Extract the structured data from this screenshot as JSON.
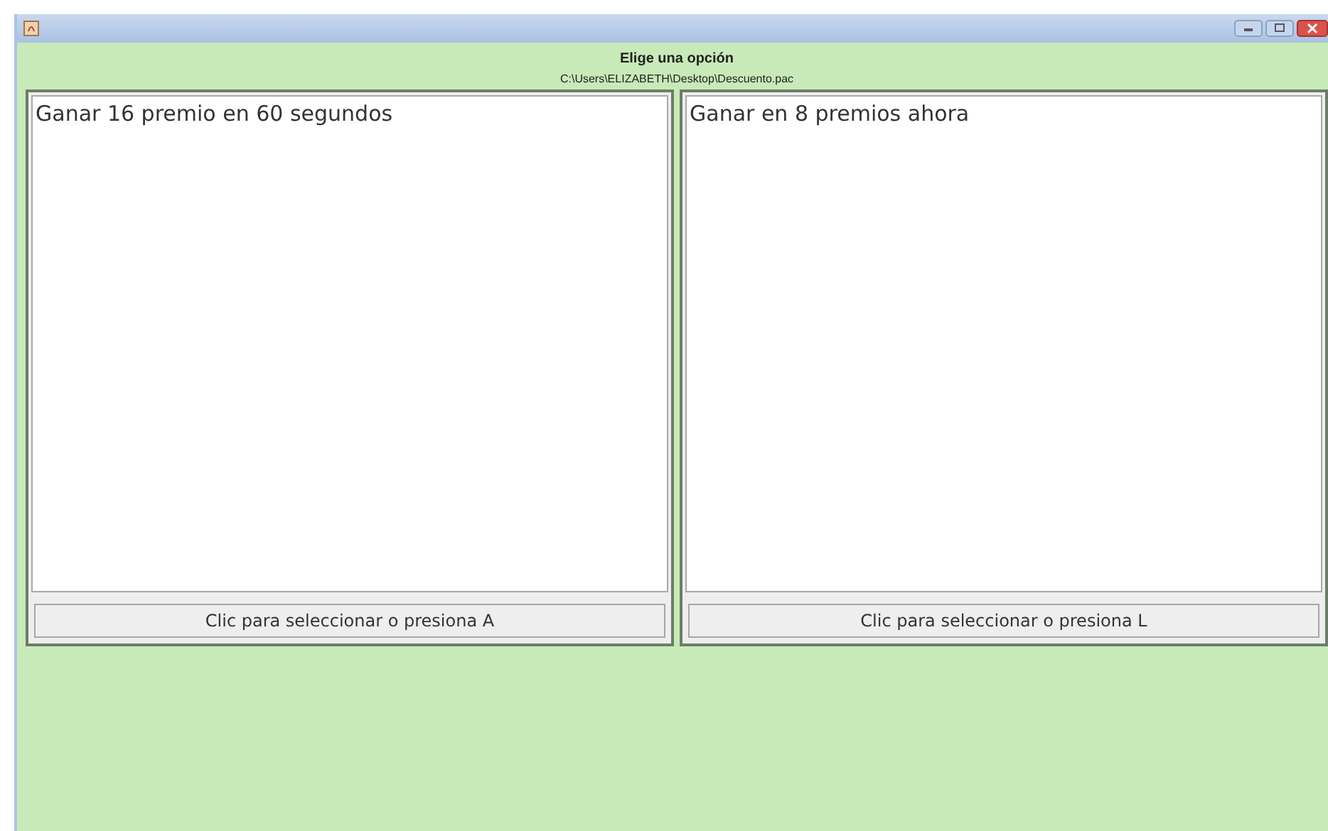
{
  "window": {
    "title_icon": true
  },
  "header": {
    "title": "Elige una opción",
    "path": "C:\\Users\\ELIZABETH\\Desktop\\Descuento.pac"
  },
  "options": [
    {
      "text": "Ganar 16 premio en 60 segundos",
      "button": "Clic para seleccionar o presiona A"
    },
    {
      "text": "Ganar en 8 premios ahora",
      "button": "Clic para seleccionar o presiona L"
    }
  ]
}
